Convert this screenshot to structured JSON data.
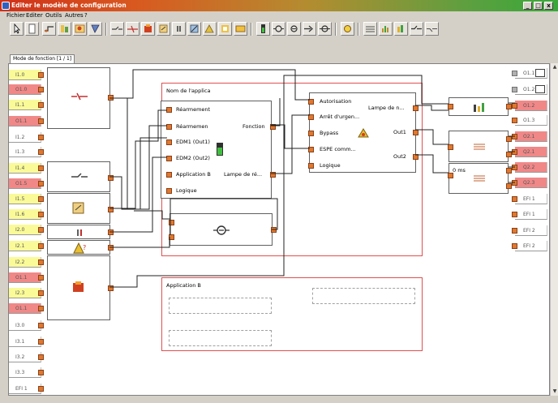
{
  "window": {
    "title": "Editer le modèle de configuration",
    "minimize_label": "_",
    "maximize_label": "□",
    "close_label": "x"
  },
  "menu": [
    "Fichier",
    "Editer",
    "Outils",
    "Autres",
    "?"
  ],
  "toolbar": {
    "buttons": [
      "pointer-icon",
      "document-icon",
      "wire-icon",
      "logic-gate-icon",
      "chart-icon",
      "plc-icon",
      "connector-icon",
      "splitter-icon",
      "fire-icon",
      "reset-icon",
      "pause-icon",
      "timer-icon",
      "counter-icon",
      "warning-icon",
      "chip-icon",
      "battery-icon",
      "relay-icon",
      "relay-icon",
      "arrow-icon",
      "relay-icon",
      "lamp-icon",
      "grid-icon",
      "chart-bar-icon",
      "chart-bar-icon",
      "connector-icon",
      "connector-icon"
    ]
  },
  "tab": {
    "label": "Mode de fonction [1 / 1]"
  },
  "colors": {
    "red": "#f08888",
    "yellow": "#fafa98",
    "port": "#e0782e",
    "red_frame": "#e05050"
  },
  "inputs": [
    {
      "label": "I1.0",
      "color": "yellow"
    },
    {
      "label": "O1.0",
      "color": "red"
    },
    {
      "label": "I1.1",
      "color": "yellow"
    },
    {
      "label": "O1.1",
      "color": "red"
    },
    {
      "label": "I1.2",
      "color": "white"
    },
    {
      "label": "I1.3",
      "color": "white"
    },
    {
      "label": "I1.4",
      "color": "yellow"
    },
    {
      "label": "O1.5",
      "color": "red"
    },
    {
      "label": "I1.5",
      "color": "yellow"
    },
    {
      "label": "I1.6",
      "color": "yellow"
    },
    {
      "label": "I2.0",
      "color": "yellow"
    },
    {
      "label": "I2.1",
      "color": "yellow"
    },
    {
      "label": "I2.2",
      "color": "yellow"
    },
    {
      "label": "O1.1",
      "color": "red"
    },
    {
      "label": "I2.3",
      "color": "yellow"
    },
    {
      "label": "O1.1",
      "color": "red"
    },
    {
      "label": "I3.0",
      "color": "white"
    },
    {
      "label": "I3.1",
      "color": "white"
    },
    {
      "label": "I3.2",
      "color": "white"
    },
    {
      "label": "I3.3",
      "color": "white"
    },
    {
      "label": "EFI 1",
      "color": "white"
    }
  ],
  "outputs": [
    {
      "label": "O1.1",
      "color": "white"
    },
    {
      "label": "O1.2",
      "color": "white"
    },
    {
      "label": "O1.2",
      "color": "red"
    },
    {
      "label": "O1.3",
      "color": "white"
    },
    {
      "label": "O2.1",
      "color": "red"
    },
    {
      "label": "Q2.1",
      "color": "red"
    },
    {
      "label": "Q2.2",
      "color": "red"
    },
    {
      "label": "Q2.3",
      "color": "red"
    },
    {
      "label": "EFI 1",
      "color": "white"
    },
    {
      "label": "EFI 1",
      "color": "white"
    },
    {
      "label": "EFI 2",
      "color": "white"
    },
    {
      "label": "EFI 2",
      "color": "white"
    }
  ],
  "blocks": {
    "app1": {
      "name": "Nom de l'applica",
      "inputs": [
        "Réarmement",
        "Réarmemen",
        "EDM1 (Out1)",
        "EDM2 (Out2)",
        "Application B",
        "Logique"
      ],
      "out_fonction": "Fonction",
      "out_lampe": "Lampe de ré..."
    },
    "fb": {
      "inputs": [
        "Autorisation",
        "Arrêt d'urgen...",
        "Bypass",
        "ESPE comm...",
        "Logique"
      ],
      "outputs": [
        "Lampe de n...",
        "Out1",
        "Out2"
      ]
    },
    "app2": {
      "name": "Application B"
    },
    "timer_label": "0 ms"
  }
}
